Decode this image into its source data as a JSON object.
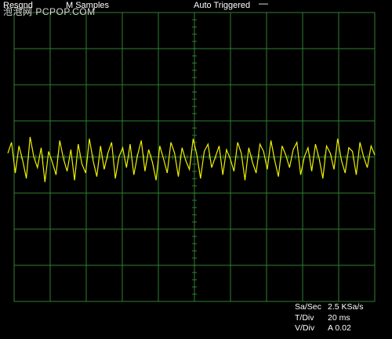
{
  "header": {
    "left_label": "Resgnd",
    "samples_label": "M Samples",
    "trigger_mode": "Auto Triggered",
    "trigger_indicator": "—",
    "watermark": "泡泡网 PCPOP.COM"
  },
  "readout": {
    "rows": [
      {
        "label": "Sa/Sec",
        "value": "2.5 KSa/s"
      },
      {
        "label": "T/Div",
        "value": "20 ms"
      },
      {
        "label": "V/Div",
        "value": "A 0.02"
      }
    ]
  },
  "colors": {
    "background": "#000000",
    "grid": "#2f7f2f",
    "trace": "#f0f000",
    "text": "#ffffff"
  },
  "chart_data": {
    "type": "line",
    "grid": true,
    "divisions": {
      "x": 10,
      "y": 8
    },
    "series": [
      {
        "values": [
          0.06,
          0.12,
          -0.05,
          0.1,
          0.02,
          -0.08,
          0.15,
          0.04,
          -0.02,
          0.09,
          -0.1,
          0.07,
          0.01,
          -0.06,
          0.13,
          0.03,
          -0.04,
          0.08,
          -0.09,
          0.11,
          0.0,
          -0.05,
          0.14,
          0.02,
          -0.07,
          0.1,
          -0.03,
          0.06,
          0.12,
          -0.08,
          0.04,
          0.09,
          -0.02,
          0.11,
          -0.06,
          0.05,
          0.13,
          -0.04,
          0.08,
          0.01,
          -0.09,
          0.1,
          0.03,
          -0.05,
          0.12,
          0.06,
          -0.07,
          0.09,
          0.02,
          -0.03,
          0.14,
          0.05,
          -0.08,
          0.07,
          0.11,
          -0.02,
          0.04,
          0.1,
          -0.06,
          0.08,
          0.03,
          -0.04,
          0.12,
          0.06,
          -0.09,
          0.09,
          0.01,
          -0.05,
          0.11,
          0.07,
          -0.03,
          0.13,
          0.02,
          -0.07,
          0.1,
          0.05,
          -0.02,
          0.08,
          0.12,
          -0.06,
          0.04,
          0.09,
          -0.04,
          0.11,
          0.03,
          -0.08,
          0.1,
          0.06,
          -0.03,
          0.14,
          0.02,
          -0.05,
          0.09,
          0.07,
          -0.06,
          0.12,
          0.04,
          -0.02,
          0.1,
          0.05
        ]
      }
    ]
  }
}
